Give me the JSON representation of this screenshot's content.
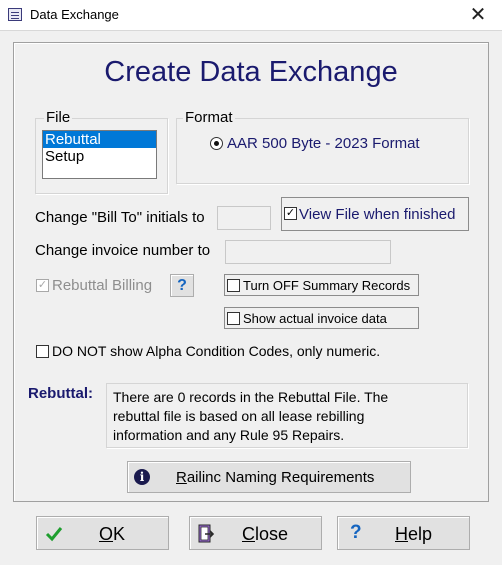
{
  "window": {
    "title": "Data Exchange",
    "close_glyph": "✕"
  },
  "heading": "Create Data Exchange",
  "file_group": {
    "label": "File",
    "items": [
      "Rebuttal",
      "Setup"
    ],
    "selected": "Rebuttal"
  },
  "format_group": {
    "label": "Format",
    "option": "AAR 500 Byte - 2023 Format",
    "selected": true
  },
  "bill_to": {
    "label": "Change \"Bill To\" initials to",
    "value": ""
  },
  "view_file": {
    "label": "View File when finished",
    "checked": true
  },
  "invoice": {
    "label": "Change invoice number to",
    "value": ""
  },
  "rebuttal_billing": {
    "label": "Rebuttal Billing",
    "checked": true,
    "enabled": false
  },
  "help_small": {
    "glyph": "?"
  },
  "summary": {
    "label": "Turn OFF Summary Records",
    "checked": false
  },
  "invoice_data": {
    "label": "Show actual invoice data",
    "checked": false
  },
  "alpha": {
    "label": "DO NOT show Alpha Condition Codes, only numeric.",
    "checked": false
  },
  "rebuttal_info": {
    "label": "Rebuttal:",
    "lines": [
      "There are 0 records in the Rebuttal File.  The",
      "rebuttal file is based on all lease rebilling",
      "information and any Rule 95 Repairs."
    ]
  },
  "naming": {
    "icon_glyph": "i",
    "first": "R",
    "rest": "ailinc Naming Requirements"
  },
  "buttons": {
    "ok": {
      "first": "O",
      "rest": "K",
      "icon": "check-icon"
    },
    "close": {
      "first": "C",
      "rest": "lose",
      "icon": "door-exit-icon"
    },
    "help": {
      "first": "H",
      "rest": "elp",
      "icon": "question-icon",
      "glyph": "?"
    }
  },
  "colors": {
    "heading": "#1a1a6e",
    "selection": "#0078d7",
    "ok_check": "#1e9e2e",
    "help_q": "#1565c0"
  }
}
